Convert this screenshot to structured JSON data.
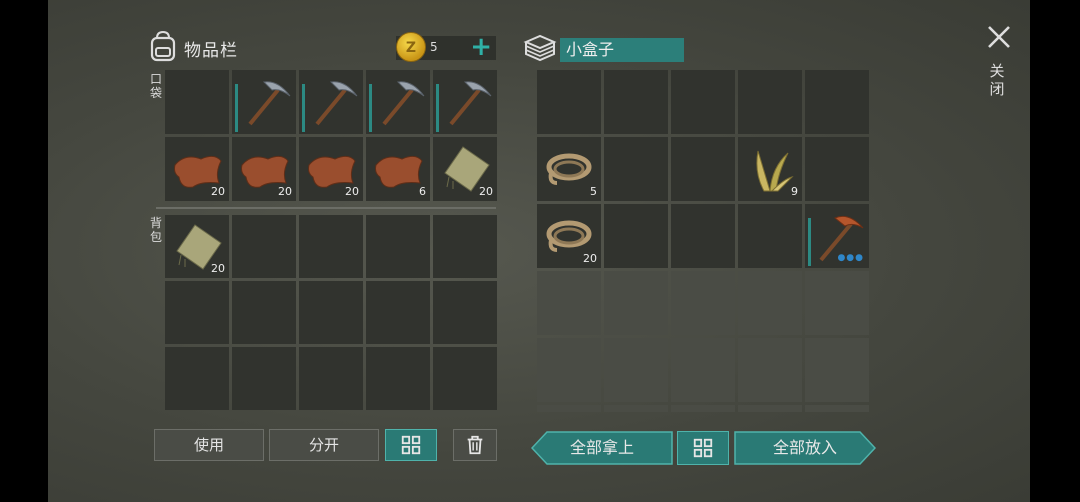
{
  "inventory": {
    "title": "物品栏",
    "pocket_label": "口袋",
    "backpack_label": "背包",
    "coins": "5",
    "pocket_row1": [
      {
        "icon": "",
        "count": ""
      },
      {
        "icon": "pickaxe",
        "count": ""
      },
      {
        "icon": "pickaxe",
        "count": ""
      },
      {
        "icon": "pickaxe",
        "count": ""
      },
      {
        "icon": "pickaxe",
        "count": ""
      }
    ],
    "pocket_row2": [
      {
        "icon": "leather",
        "count": "20"
      },
      {
        "icon": "leather",
        "count": "20"
      },
      {
        "icon": "leather",
        "count": "20"
      },
      {
        "icon": "leather",
        "count": "6"
      },
      {
        "icon": "cloth",
        "count": "20"
      }
    ],
    "backpack_row1_first": {
      "icon": "cloth",
      "count": "20"
    }
  },
  "container": {
    "name": "小盒子",
    "row2": [
      {
        "icon": "rope",
        "count": "5"
      },
      {
        "icon": "",
        "count": ""
      },
      {
        "icon": "",
        "count": ""
      },
      {
        "icon": "plant-fiber",
        "count": "9"
      },
      {
        "icon": "",
        "count": ""
      }
    ],
    "row3": [
      {
        "icon": "rope",
        "count": "20"
      },
      {
        "icon": "",
        "count": ""
      },
      {
        "icon": "",
        "count": ""
      },
      {
        "icon": "",
        "count": ""
      },
      {
        "icon": "copper-pickaxe",
        "count": ""
      }
    ]
  },
  "buttons": {
    "use": "使用",
    "split": "分开",
    "take_all": "全部拿上",
    "put_all": "全部放入"
  },
  "close_label": "关闭",
  "colors": {
    "accent": "#2c7f7a",
    "slot_bg": "#31332e",
    "panel_bg": "#45473f"
  }
}
